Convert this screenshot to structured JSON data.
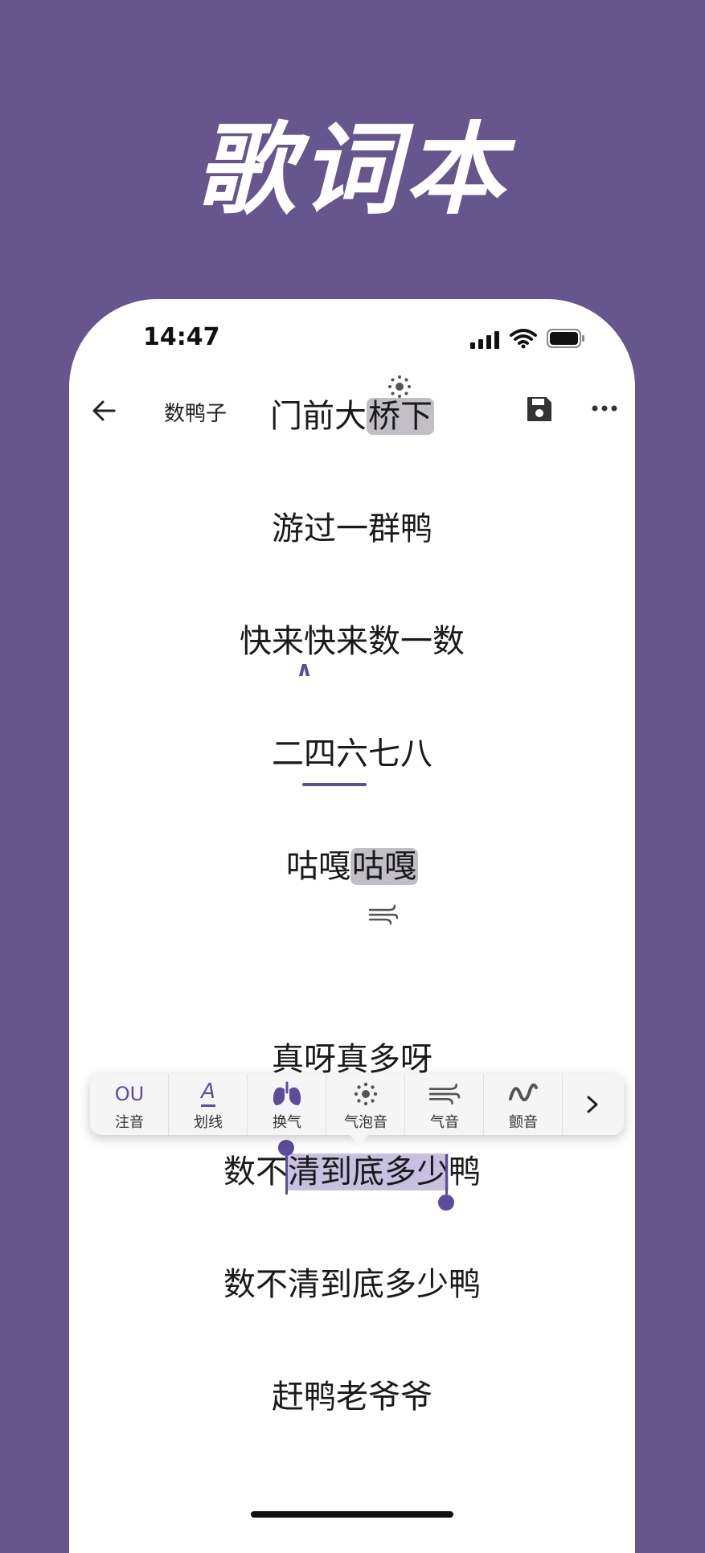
{
  "hero": {
    "title": "歌词本"
  },
  "status": {
    "time": "14:47"
  },
  "nav": {
    "title": "数鸭子"
  },
  "lyrics": [
    {
      "pre": "门前大",
      "hl": "桥下",
      "post": ""
    },
    {
      "text": "游过一群鸭"
    },
    {
      "text": "快来快来数一数"
    },
    {
      "text": "二四六七八"
    },
    {
      "pre": "咕嘎",
      "hl": "咕嘎",
      "post": ""
    },
    {
      "text": "真呀真多呀"
    },
    {
      "pre": "数不",
      "hl": "清到底多少",
      "post": "鸭"
    },
    {
      "text": "数不清到底多少鸭"
    },
    {
      "text": "赶鸭老爷爷"
    }
  ],
  "toolbar": {
    "items": [
      {
        "icon_text": "OU",
        "label": "注音"
      },
      {
        "label": "划线"
      },
      {
        "label": "换气"
      },
      {
        "label": "气泡音"
      },
      {
        "label": "气音"
      },
      {
        "label": "颤音"
      }
    ],
    "underline_glyph": "A",
    "caret_glyph": "∧"
  },
  "colors": {
    "background": "#67558e",
    "accent": "#5e4c9a",
    "highlight_gray": "#c2bec7",
    "highlight_purple": "#c8c0e0"
  },
  "icons": [
    "arrow-left-icon",
    "save-icon",
    "more-icon",
    "bubble-icon",
    "breath-icon",
    "wind-icon",
    "vibrato-icon",
    "chevron-right-icon"
  ]
}
